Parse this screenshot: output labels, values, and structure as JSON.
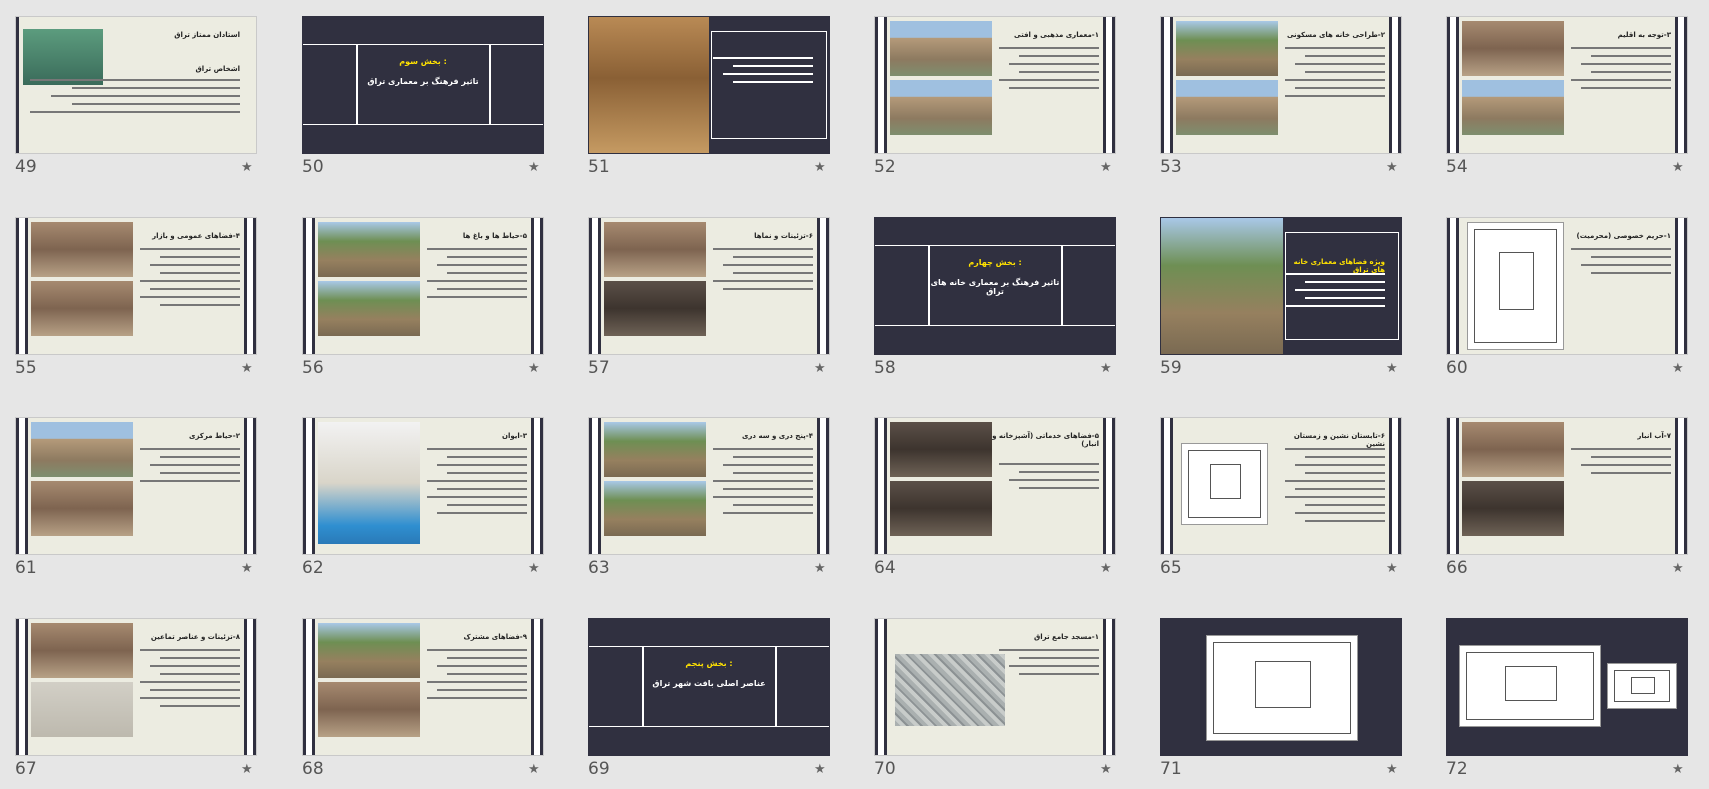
{
  "app": "Slide Sorter",
  "slides": [
    {
      "number": "49",
      "kind": "content",
      "title": "استادان ممتاز تراق",
      "caption": "اشخاص تراق"
    },
    {
      "number": "50",
      "kind": "section",
      "kicker": "بخش سوم :",
      "title": "تاثیر فرهنگ بر معماری تراق"
    },
    {
      "number": "51",
      "kind": "content",
      "title": ""
    },
    {
      "number": "52",
      "kind": "content",
      "title": "۱-معماری مذهبی و افتی"
    },
    {
      "number": "53",
      "kind": "content",
      "title": "۲-طراحی خانه های مسکونی"
    },
    {
      "number": "54",
      "kind": "content",
      "title": "۳-توجه به اقلیم"
    },
    {
      "number": "55",
      "kind": "content",
      "title": "۴-فضاهای عمومی و بازار"
    },
    {
      "number": "56",
      "kind": "content",
      "title": "۵-حیاط ها و باغ ها"
    },
    {
      "number": "57",
      "kind": "content",
      "title": "۶-تزئینات و نماها"
    },
    {
      "number": "58",
      "kind": "section",
      "kicker": "بخش چهارم :",
      "title": "تاثیر فرهنگ بر معماری خانه های تراق"
    },
    {
      "number": "59",
      "kind": "content",
      "title": "ویژه فضاهای معماری خانه های تراق"
    },
    {
      "number": "60",
      "kind": "content",
      "title": "۱-حریم خصوصی (محرمیت)"
    },
    {
      "number": "61",
      "kind": "content",
      "title": "۲-حیاط مرکزی"
    },
    {
      "number": "62",
      "kind": "content",
      "title": "۳-ایوان"
    },
    {
      "number": "63",
      "kind": "content",
      "title": "۴-پنج دری و سه دری"
    },
    {
      "number": "64",
      "kind": "content",
      "title": "۵-فضاهای خدماتی (آشپزخانه و انبار)"
    },
    {
      "number": "65",
      "kind": "content",
      "title": "۶-تابستان نشین و زمستان نشین"
    },
    {
      "number": "66",
      "kind": "content",
      "title": "۷-آب انبار"
    },
    {
      "number": "67",
      "kind": "content",
      "title": "۸-تزئینات و عناصر تماعین"
    },
    {
      "number": "68",
      "kind": "content",
      "title": "۹-فضاهای مشترک"
    },
    {
      "number": "69",
      "kind": "section",
      "kicker": "بخش پنجم :",
      "title": "عناصر اصلی بافت شهر تراق"
    },
    {
      "number": "70",
      "kind": "content",
      "title": "۱-مسجد جامع تراق"
    },
    {
      "number": "71",
      "kind": "plan",
      "title": ""
    },
    {
      "number": "72",
      "kind": "plan",
      "title": ""
    }
  ],
  "star_icon": "star-icon"
}
